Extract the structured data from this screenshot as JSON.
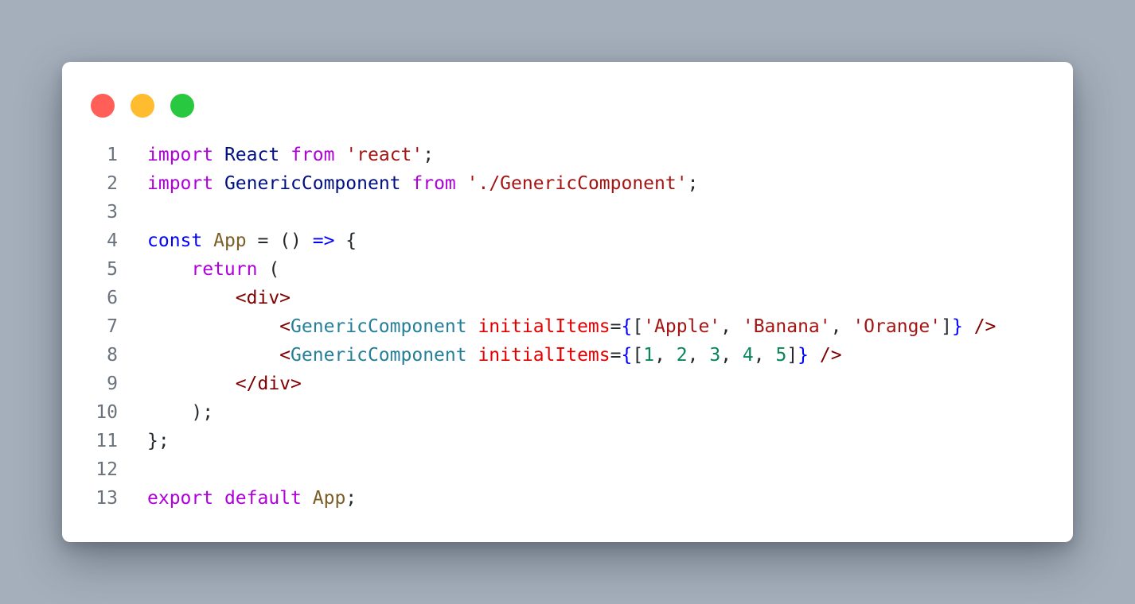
{
  "window_controls": {
    "close_color": "#ff5f57",
    "minimize_color": "#febc2e",
    "maximize_color": "#28c840"
  },
  "editor": {
    "lines": [
      {
        "num": "1",
        "tokens": [
          {
            "t": "import",
            "c": "kw"
          },
          {
            "t": " ",
            "c": "punc"
          },
          {
            "t": "React",
            "c": "ident"
          },
          {
            "t": " ",
            "c": "punc"
          },
          {
            "t": "from",
            "c": "kw"
          },
          {
            "t": " ",
            "c": "punc"
          },
          {
            "t": "'react'",
            "c": "str"
          },
          {
            "t": ";",
            "c": "punc"
          }
        ]
      },
      {
        "num": "2",
        "tokens": [
          {
            "t": "import",
            "c": "kw"
          },
          {
            "t": " ",
            "c": "punc"
          },
          {
            "t": "GenericComponent",
            "c": "ident"
          },
          {
            "t": " ",
            "c": "punc"
          },
          {
            "t": "from",
            "c": "kw"
          },
          {
            "t": " ",
            "c": "punc"
          },
          {
            "t": "'./GenericComponent'",
            "c": "str"
          },
          {
            "t": ";",
            "c": "punc"
          }
        ]
      },
      {
        "num": "3",
        "tokens": []
      },
      {
        "num": "4",
        "tokens": [
          {
            "t": "const",
            "c": "const"
          },
          {
            "t": " ",
            "c": "punc"
          },
          {
            "t": "App",
            "c": "fn"
          },
          {
            "t": " = () ",
            "c": "punc"
          },
          {
            "t": "=>",
            "c": "const"
          },
          {
            "t": " {",
            "c": "punc"
          }
        ]
      },
      {
        "num": "5",
        "tokens": [
          {
            "t": "    ",
            "c": "punc"
          },
          {
            "t": "return",
            "c": "kw"
          },
          {
            "t": " (",
            "c": "punc"
          }
        ]
      },
      {
        "num": "6",
        "tokens": [
          {
            "t": "        ",
            "c": "punc"
          },
          {
            "t": "<div>",
            "c": "tag"
          }
        ]
      },
      {
        "num": "7",
        "tokens": [
          {
            "t": "            ",
            "c": "punc"
          },
          {
            "t": "<",
            "c": "tag"
          },
          {
            "t": "GenericComponent",
            "c": "comp"
          },
          {
            "t": " ",
            "c": "punc"
          },
          {
            "t": "initialItems",
            "c": "attr"
          },
          {
            "t": "=",
            "c": "punc"
          },
          {
            "t": "{",
            "c": "brace"
          },
          {
            "t": "[",
            "c": "punc"
          },
          {
            "t": "'Apple'",
            "c": "str"
          },
          {
            "t": ", ",
            "c": "punc"
          },
          {
            "t": "'Banana'",
            "c": "str"
          },
          {
            "t": ", ",
            "c": "punc"
          },
          {
            "t": "'Orange'",
            "c": "str"
          },
          {
            "t": "]",
            "c": "punc"
          },
          {
            "t": "}",
            "c": "brace"
          },
          {
            "t": " ",
            "c": "punc"
          },
          {
            "t": "/>",
            "c": "tag"
          }
        ]
      },
      {
        "num": "8",
        "tokens": [
          {
            "t": "            ",
            "c": "punc"
          },
          {
            "t": "<",
            "c": "tag"
          },
          {
            "t": "GenericComponent",
            "c": "comp"
          },
          {
            "t": " ",
            "c": "punc"
          },
          {
            "t": "initialItems",
            "c": "attr"
          },
          {
            "t": "=",
            "c": "punc"
          },
          {
            "t": "{",
            "c": "brace"
          },
          {
            "t": "[",
            "c": "punc"
          },
          {
            "t": "1",
            "c": "num"
          },
          {
            "t": ", ",
            "c": "punc"
          },
          {
            "t": "2",
            "c": "num"
          },
          {
            "t": ", ",
            "c": "punc"
          },
          {
            "t": "3",
            "c": "num"
          },
          {
            "t": ", ",
            "c": "punc"
          },
          {
            "t": "4",
            "c": "num"
          },
          {
            "t": ", ",
            "c": "punc"
          },
          {
            "t": "5",
            "c": "num"
          },
          {
            "t": "]",
            "c": "punc"
          },
          {
            "t": "}",
            "c": "brace"
          },
          {
            "t": " ",
            "c": "punc"
          },
          {
            "t": "/>",
            "c": "tag"
          }
        ]
      },
      {
        "num": "9",
        "tokens": [
          {
            "t": "        ",
            "c": "punc"
          },
          {
            "t": "</div>",
            "c": "tag"
          }
        ]
      },
      {
        "num": "10",
        "tokens": [
          {
            "t": "    );",
            "c": "punc"
          }
        ]
      },
      {
        "num": "11",
        "tokens": [
          {
            "t": "};",
            "c": "punc"
          }
        ]
      },
      {
        "num": "12",
        "tokens": []
      },
      {
        "num": "13",
        "tokens": [
          {
            "t": "export",
            "c": "kw"
          },
          {
            "t": " ",
            "c": "punc"
          },
          {
            "t": "default",
            "c": "kw"
          },
          {
            "t": " ",
            "c": "punc"
          },
          {
            "t": "App",
            "c": "fn"
          },
          {
            "t": ";",
            "c": "punc"
          }
        ]
      }
    ]
  }
}
